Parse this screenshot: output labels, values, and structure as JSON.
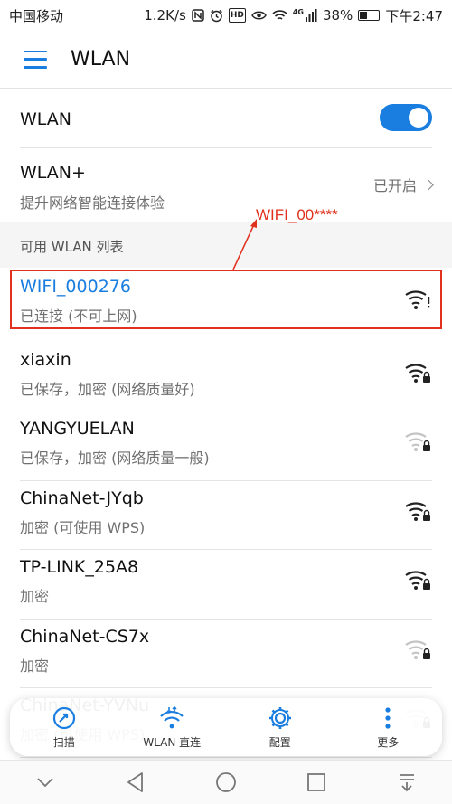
{
  "status_bar": {
    "carrier": "中国移动",
    "speed": "1.2K/s",
    "nfc_icon": "nfc-icon",
    "hd_label": "HD",
    "network_type": "4G",
    "battery_level": "38%",
    "time": "下午2:47"
  },
  "header": {
    "title": "WLAN",
    "menu_icon": "hamburger-menu-icon"
  },
  "wlan_toggle": {
    "label": "WLAN",
    "enabled": true,
    "accent": "#1a7ee0"
  },
  "wlan_plus": {
    "title": "WLAN+",
    "subtitle": "提升网络智能连接体验",
    "status": "已开启"
  },
  "network_list": {
    "header": "可用 WLAN 列表",
    "annotation": "WIFI_00****",
    "annotation_color": "#e0301e",
    "networks": [
      {
        "ssid": "WIFI_000276",
        "status": "已连接 (不可上网)",
        "signal": "full",
        "locked": false,
        "warning": true,
        "connected": true
      },
      {
        "ssid": "xiaxin",
        "status": "已保存，加密 (网络质量好)",
        "signal": "full",
        "locked": true,
        "warning": false,
        "connected": false
      },
      {
        "ssid": "YANGYUELAN",
        "status": "已保存，加密 (网络质量一般)",
        "signal": "weak",
        "locked": true,
        "warning": false,
        "connected": false
      },
      {
        "ssid": "ChinaNet-JYqb",
        "status": "加密 (可使用 WPS)",
        "signal": "full",
        "locked": true,
        "warning": false,
        "connected": false
      },
      {
        "ssid": "TP-LINK_25A8",
        "status": "加密",
        "signal": "full",
        "locked": true,
        "warning": false,
        "connected": false
      },
      {
        "ssid": "ChinaNet-CS7x",
        "status": "加密",
        "signal": "weak",
        "locked": true,
        "warning": false,
        "connected": false
      },
      {
        "ssid": "ChinaNet-YVNu",
        "status": "加密 (可使用 WPS)",
        "signal": "weak",
        "locked": true,
        "warning": false,
        "connected": false
      }
    ]
  },
  "toolbar": {
    "items": [
      {
        "label": "扫描",
        "icon": "scan-icon"
      },
      {
        "label": "WLAN 直连",
        "icon": "wlan-direct-icon"
      },
      {
        "label": "配置",
        "icon": "settings-gear-icon"
      },
      {
        "label": "更多",
        "icon": "more-vertical-icon"
      }
    ]
  },
  "nav_bar": {
    "items": [
      "collapse-icon",
      "back-icon",
      "home-icon",
      "recents-icon",
      "notification-pull-icon"
    ]
  }
}
